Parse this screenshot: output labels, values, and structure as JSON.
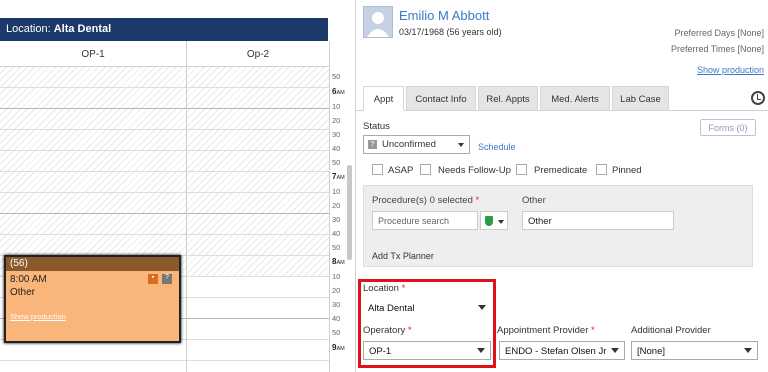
{
  "location_bar": {
    "prefix": "Location: ",
    "name": "Alta Dental"
  },
  "columns": [
    "OP-1",
    "Op-2"
  ],
  "time_labels": [
    "50",
    "6",
    "10",
    "20",
    "30",
    "40",
    "50",
    "7",
    "10",
    "20",
    "30",
    "40",
    "50",
    "8",
    "10",
    "20",
    "30",
    "40",
    "50",
    "9"
  ],
  "am": "AM",
  "appointment": {
    "header": "(56)",
    "time": "8:00 AM",
    "type": "Other",
    "link": "Show production"
  },
  "patient": {
    "name": "Emilio M Abbott",
    "dob": "03/17/1968 (56 years old)",
    "preferred_days": "Preferred Days [None]",
    "preferred_times": "Preferred Times [None]",
    "show_production": "Show production"
  },
  "tabs": [
    "Appt",
    "Contact Info",
    "Rel. Appts",
    "Med. Alerts",
    "Lab Case"
  ],
  "forms_button": "Forms (0)",
  "status": {
    "label": "Status",
    "value": "Unconfirmed",
    "schedule_link": "Schedule"
  },
  "checkboxes": [
    "ASAP",
    "Needs Follow-Up",
    "Premedicate",
    "Pinned"
  ],
  "procedures": {
    "label": "Procedure(s)",
    "count": "0 selected",
    "placeholder": "Procedure search",
    "other_label": "Other",
    "other_value": "Other",
    "add_tx": "Add Tx Planner"
  },
  "location_field": {
    "label": "Location",
    "value": "Alta Dental"
  },
  "operatory_field": {
    "label": "Operatory",
    "value": "OP-1"
  },
  "appt_provider": {
    "label": "Appointment Provider",
    "value": "ENDO - Stefan Olsen Jr"
  },
  "additional_provider": {
    "label": "Additional Provider",
    "value": "[None]"
  },
  "required_mark": "*"
}
